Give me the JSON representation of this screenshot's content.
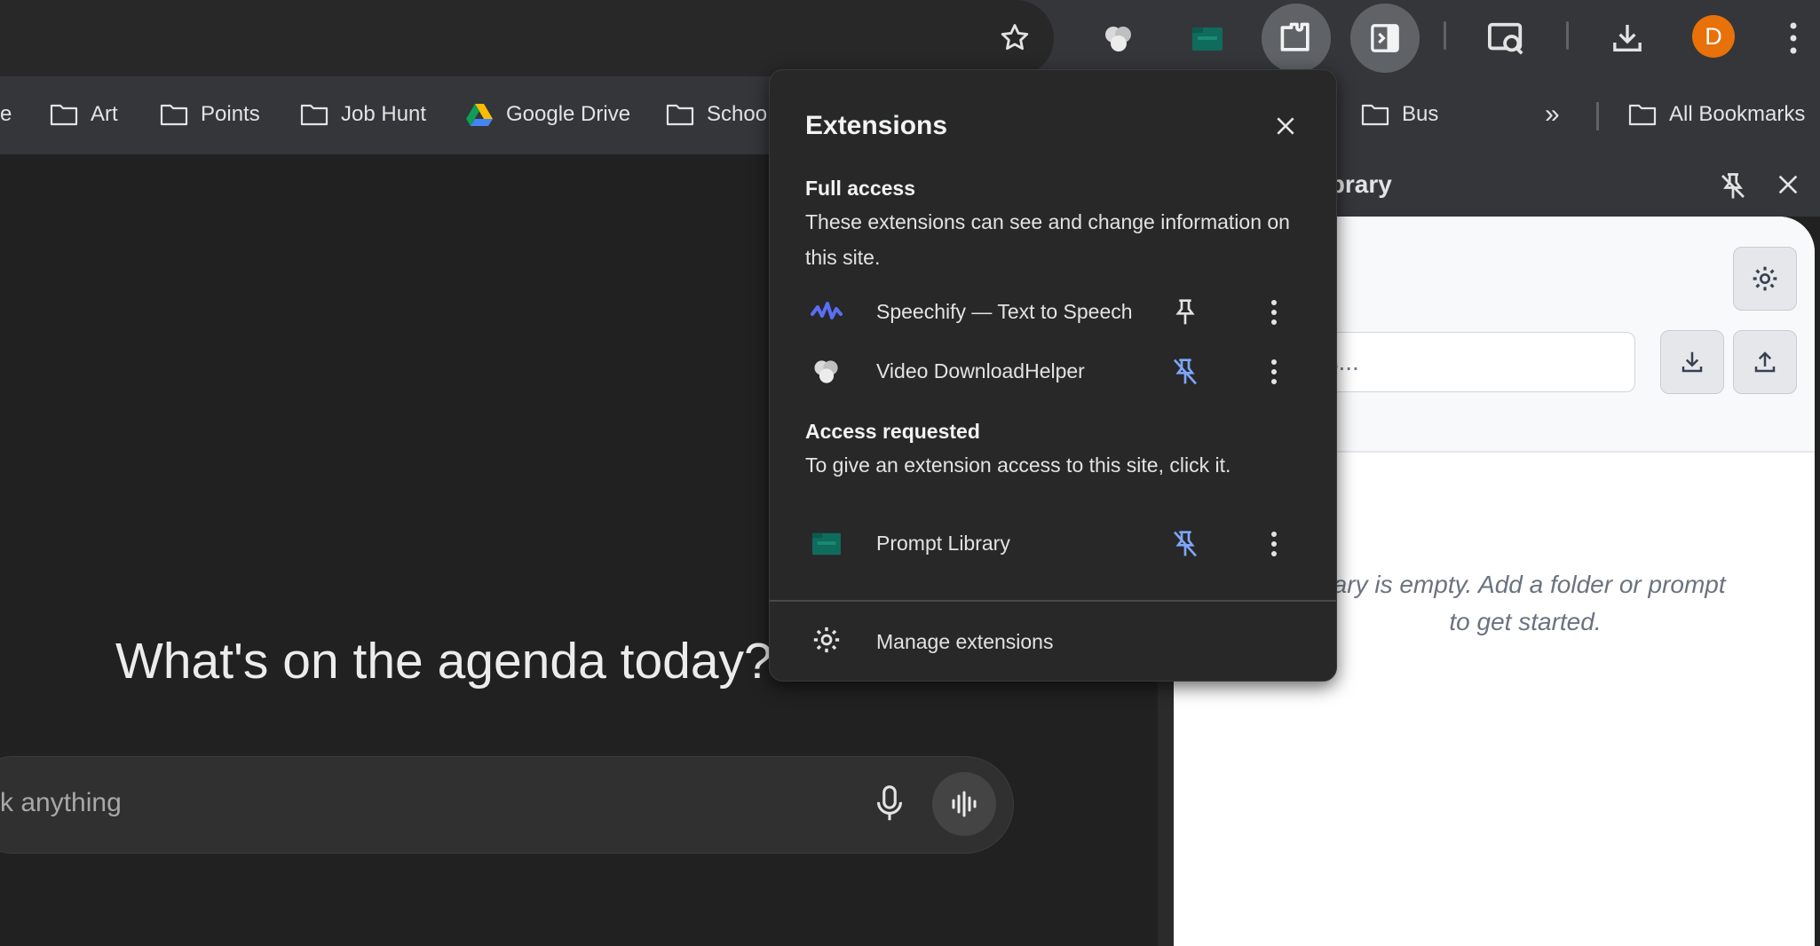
{
  "toolbar": {
    "avatar_initial": "D",
    "accent_avatar": "#e8710a"
  },
  "bookmarks": {
    "items": [
      {
        "label": "e"
      },
      {
        "label": "Art"
      },
      {
        "label": "Points"
      },
      {
        "label": "Job Hunt"
      },
      {
        "label": "Google Drive"
      },
      {
        "label": "Schoo"
      },
      {
        "label": "Bus"
      }
    ],
    "overflow_label": "»",
    "all_bookmarks": "All Bookmarks"
  },
  "main": {
    "headline": "What's on the agenda today?",
    "chat_placeholder": "k anything"
  },
  "side_panel": {
    "title": "ibrary",
    "search_placeholder": "n prompts...",
    "empty_line1": "rary is empty. Add a folder or prompt",
    "empty_line2": "to get started."
  },
  "extensions_popup": {
    "title": "Extensions",
    "full_access": {
      "heading": "Full access",
      "description": "These extensions can see and change information on this site.",
      "items": [
        {
          "name": "Speechify — Text to Speech",
          "icon": "speechify-icon",
          "pinned": true
        },
        {
          "name": "Video DownloadHelper",
          "icon": "video-downloadhelper-icon",
          "pinned": false
        }
      ]
    },
    "access_requested": {
      "heading": "Access requested",
      "description": "To give an extension access to this site, click it.",
      "items": [
        {
          "name": "Prompt Library",
          "icon": "prompt-library-icon",
          "pinned": false
        }
      ]
    },
    "manage_label": "Manage extensions",
    "pin_active_color": "#e3e3e3",
    "pin_inactive_color": "#7ea6f8"
  }
}
